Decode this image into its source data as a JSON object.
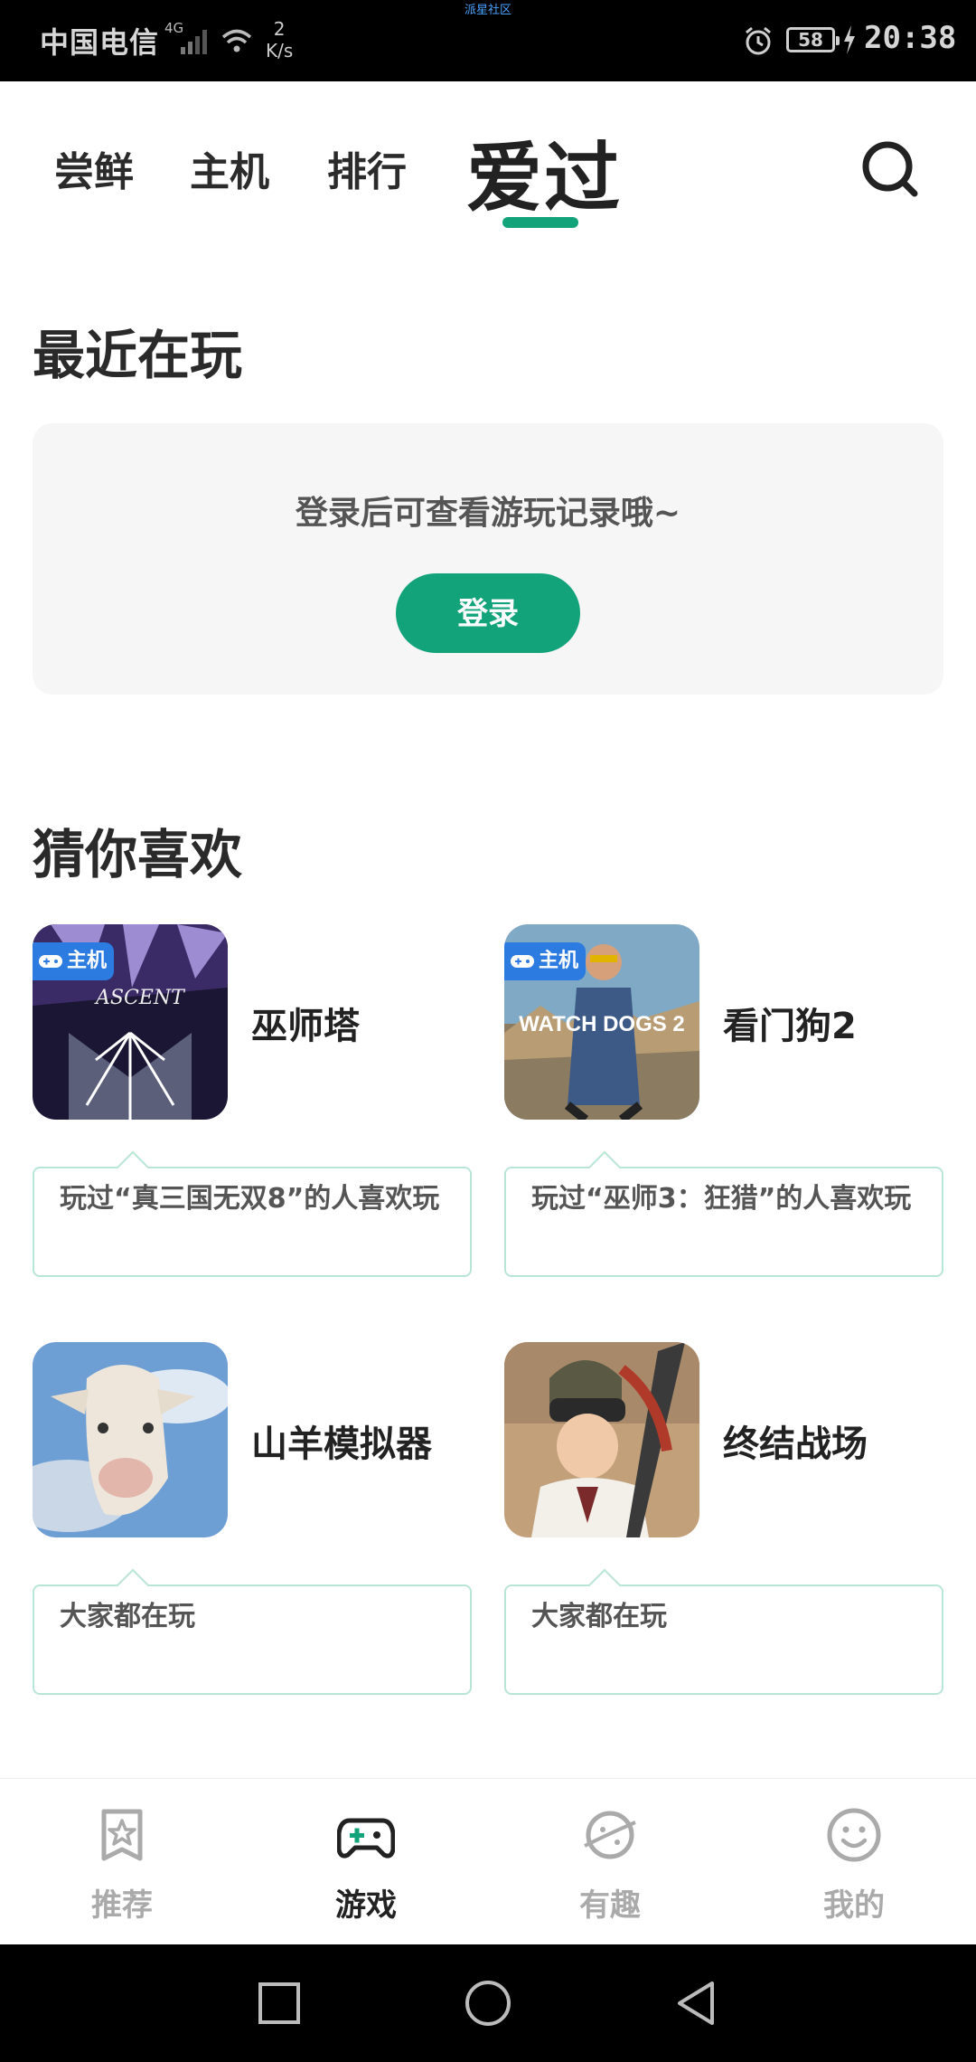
{
  "status_bar": {
    "carrier": "中国电信",
    "network": "4G",
    "speed_value": "2",
    "speed_unit": "K/s",
    "notch_text": "派星社区",
    "battery": "58",
    "time": "20:38"
  },
  "top_tabs": {
    "items": [
      "尝鲜",
      "主机",
      "排行"
    ],
    "active": "爱过"
  },
  "recent": {
    "title": "最近在玩",
    "message": "登录后可查看游玩记录哦~",
    "login_label": "登录"
  },
  "recommend": {
    "title": "猜你喜欢",
    "games": [
      {
        "name": "巫师塔",
        "tag": "主机",
        "reason": "玩过“真三国无双8”的人喜欢玩"
      },
      {
        "name": "看门狗2",
        "tag": "主机",
        "cover_text": "WATCH DOGS 2",
        "reason": "玩过“巫师3：狂猎”的人喜欢玩"
      },
      {
        "name": "山羊模拟器",
        "reason": "大家都在玩"
      },
      {
        "name": "终结战场",
        "reason": "大家都在玩"
      }
    ],
    "cover1_text": "ASCENT"
  },
  "bottom_nav": {
    "items": [
      {
        "label": "推荐",
        "icon": "star-bookmark-icon"
      },
      {
        "label": "游戏",
        "icon": "gamepad-icon",
        "active": true
      },
      {
        "label": "有趣",
        "icon": "planet-icon"
      },
      {
        "label": "我的",
        "icon": "smiley-icon"
      }
    ]
  },
  "colors": {
    "accent": "#12a37a",
    "tag_blue": "#2c7be0",
    "reason_border": "#b8e6d4"
  }
}
